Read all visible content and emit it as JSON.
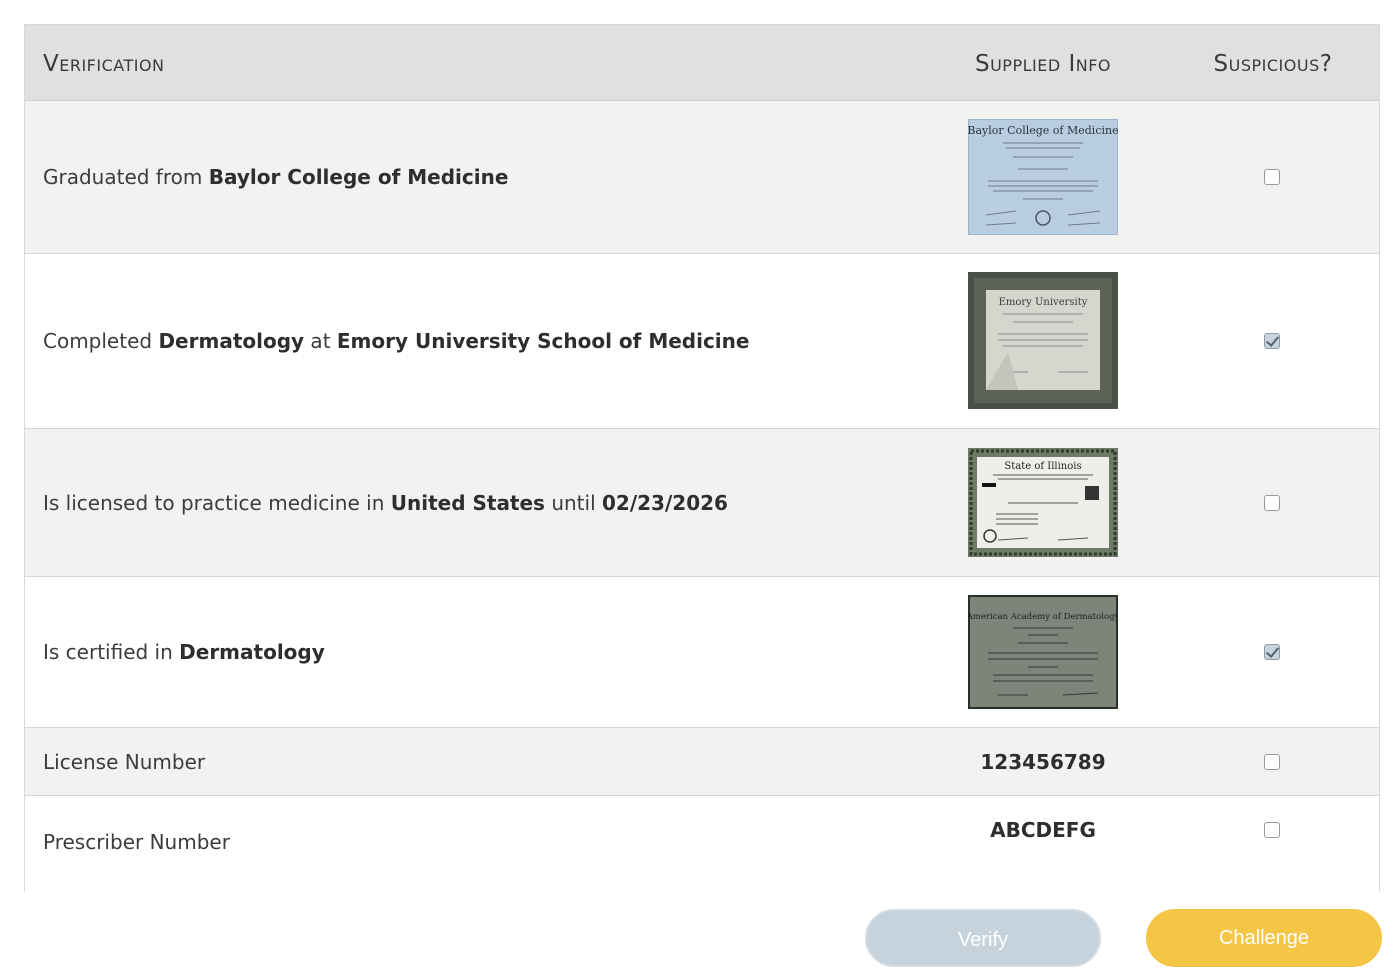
{
  "header": {
    "verification": "Verification",
    "supplied_info": "Supplied Info",
    "suspicious": "Suspicious?"
  },
  "rows": [
    {
      "parts": [
        {
          "text": "Graduated from ",
          "bold": false
        },
        {
          "text": "Baylor College of Medicine",
          "bold": true
        }
      ],
      "supplied_type": "image",
      "supplied_title": "Baylor College of Medicine",
      "image_tone": "light blue diploma",
      "suspicious": false
    },
    {
      "parts": [
        {
          "text": "Completed ",
          "bold": false
        },
        {
          "text": "Dermatology",
          "bold": true
        },
        {
          "text": " at ",
          "bold": false
        },
        {
          "text": "Emory University School of Medicine",
          "bold": true
        }
      ],
      "supplied_type": "image",
      "supplied_title": "Emory University",
      "image_tone": "framed diploma",
      "suspicious": true
    },
    {
      "parts": [
        {
          "text": "Is licensed to practice medicine in ",
          "bold": false
        },
        {
          "text": "United States",
          "bold": true
        },
        {
          "text": " until ",
          "bold": false
        },
        {
          "text": "02/23/2026",
          "bold": true
        }
      ],
      "supplied_type": "image",
      "supplied_title": "State of Illinois",
      "image_tone": "license certificate",
      "suspicious": false
    },
    {
      "parts": [
        {
          "text": "Is certified in ",
          "bold": false
        },
        {
          "text": "Dermatology",
          "bold": true
        }
      ],
      "supplied_type": "image",
      "supplied_title": "American Academy of Dermatology",
      "image_tone": "green certificate",
      "suspicious": true
    },
    {
      "parts": [
        {
          "text": "License Number",
          "bold": false
        }
      ],
      "supplied_type": "text",
      "supplied_value": "123456789",
      "suspicious": false
    },
    {
      "parts": [
        {
          "text": "Prescriber Number",
          "bold": false
        }
      ],
      "supplied_type": "text",
      "supplied_value": "ABCDEFG",
      "suspicious": false
    }
  ],
  "buttons": {
    "verify": "Verify",
    "challenge": "Challenge"
  },
  "colors": {
    "header_bg": "#e0e0e0",
    "row_gray": "#f2f2f1",
    "verify_button": "#c7d3dc",
    "challenge_button": "#f5c545"
  }
}
